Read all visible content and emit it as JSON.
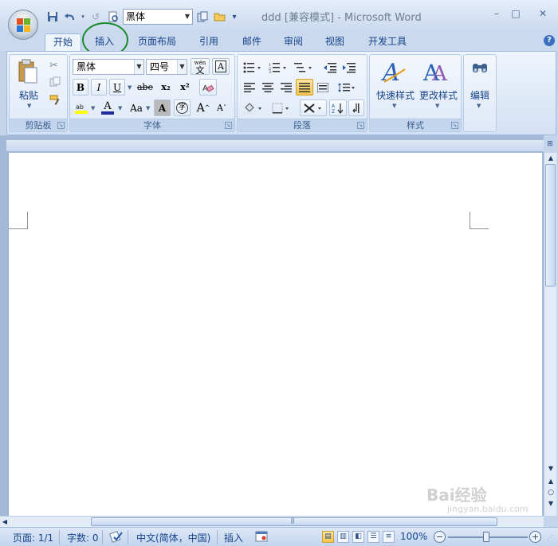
{
  "window": {
    "title": "ddd [兼容模式] - Microsoft Word",
    "controls": {
      "minimize": "–",
      "maximize": "□",
      "close": "✕"
    }
  },
  "qat": {
    "font_value": "黑体",
    "customize": "▾"
  },
  "tabs": [
    {
      "label": "开始"
    },
    {
      "label": "插入"
    },
    {
      "label": "页面布局"
    },
    {
      "label": "引用"
    },
    {
      "label": "邮件"
    },
    {
      "label": "审阅"
    },
    {
      "label": "视图"
    },
    {
      "label": "开发工具"
    }
  ],
  "help": "?",
  "ribbon": {
    "clipboard": {
      "label": "剪贴板",
      "paste": "粘贴"
    },
    "font": {
      "label": "字体",
      "font_name": "黑体",
      "font_size": "四号",
      "wen": "wén",
      "wen_char": "文",
      "char_border": "A",
      "bold": "B",
      "italic": "I",
      "underline": "U",
      "strike": "abe",
      "subscript": "x₂",
      "superscript": "x²",
      "font_color": "A",
      "change_case": "Aa",
      "char_shade": "A",
      "enclosed": "字",
      "grow": "A",
      "shrink": "A"
    },
    "paragraph": {
      "label": "段落"
    },
    "styles": {
      "label": "样式",
      "quick_styles": "快速样式",
      "change_styles": "更改样式"
    },
    "editing": {
      "label": "编辑"
    }
  },
  "status": {
    "page": "页面: 1/1",
    "words": "字数: 0",
    "language": "中文(简体，中国)",
    "mode": "插入",
    "zoom": "100%",
    "zoom_level": 1.0
  },
  "watermark": {
    "main": "Bai经验",
    "sub": "jingyan.baidu.com"
  },
  "colors": {
    "accent": "#15428b",
    "ribbon": "#dbe7f6",
    "highlight": "#f6c44e",
    "annotation": "#1b8a2c"
  }
}
